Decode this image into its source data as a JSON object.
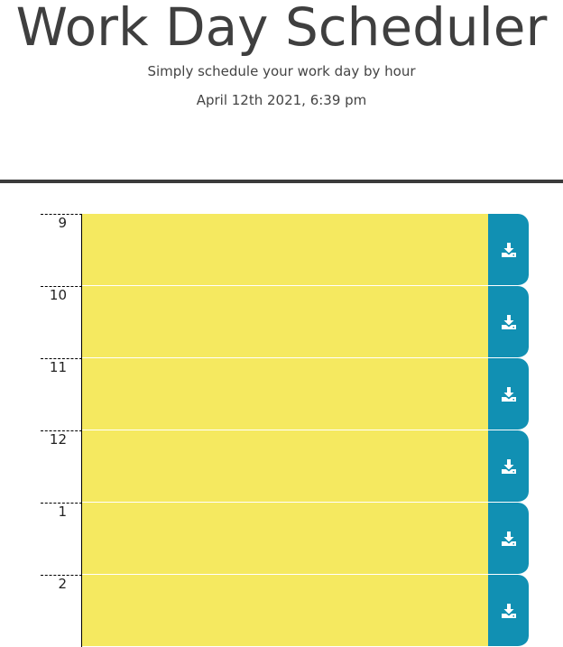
{
  "header": {
    "title": "Work Day Scheduler",
    "subtitle": "Simply schedule your work day by hour",
    "current_day": "April 12th 2021, 6:39 pm"
  },
  "time_blocks": [
    {
      "hour": "9",
      "description": "",
      "status": "future",
      "status_color": "#f5e960"
    },
    {
      "hour": "10",
      "description": "",
      "status": "future",
      "status_color": "#f5e960"
    },
    {
      "hour": "11",
      "description": "",
      "status": "future",
      "status_color": "#f5e960"
    },
    {
      "hour": "12",
      "description": "",
      "status": "future",
      "status_color": "#f5e960"
    },
    {
      "hour": "1",
      "description": "",
      "status": "future",
      "status_color": "#f5e960"
    },
    {
      "hour": "2",
      "description": "",
      "status": "future",
      "status_color": "#f5e960"
    }
  ],
  "save_button": {
    "icon": "save-icon",
    "color": "#1190b3"
  }
}
